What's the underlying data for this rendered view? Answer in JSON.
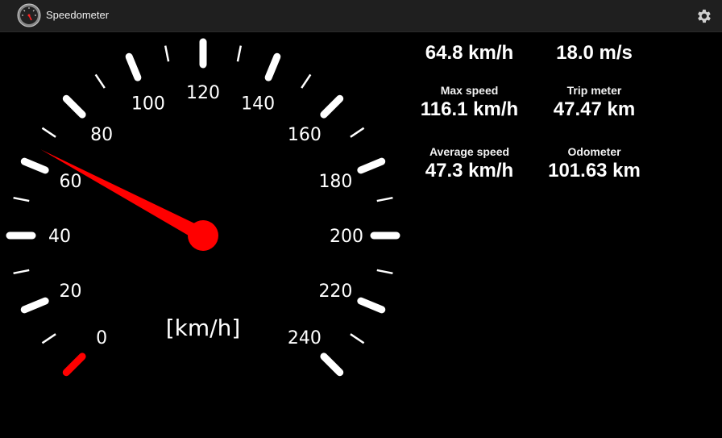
{
  "app": {
    "title": "Speedometer",
    "icon": "speedometer-app-icon",
    "settings_icon": "gear-icon"
  },
  "gauge": {
    "unit_label": "[km/h]",
    "tick_labels": [
      "0",
      "20",
      "40",
      "60",
      "80",
      "100",
      "120",
      "140",
      "160",
      "180",
      "200",
      "220",
      "240"
    ],
    "min": 0,
    "max": 240,
    "current_speed": 64.8,
    "needle_color": "#ff0000",
    "redline_tick_color": "#ff0000"
  },
  "stats": {
    "current_kmh": "64.8 km/h",
    "current_ms": "18.0 m/s",
    "max_speed_label": "Max speed",
    "max_speed_value": "116.1 km/h",
    "trip_meter_label": "Trip meter",
    "trip_meter_value": "47.47 km",
    "average_speed_label": "Average speed",
    "average_speed_value": "47.3 km/h",
    "odometer_label": "Odometer",
    "odometer_value": "101.63 km"
  }
}
